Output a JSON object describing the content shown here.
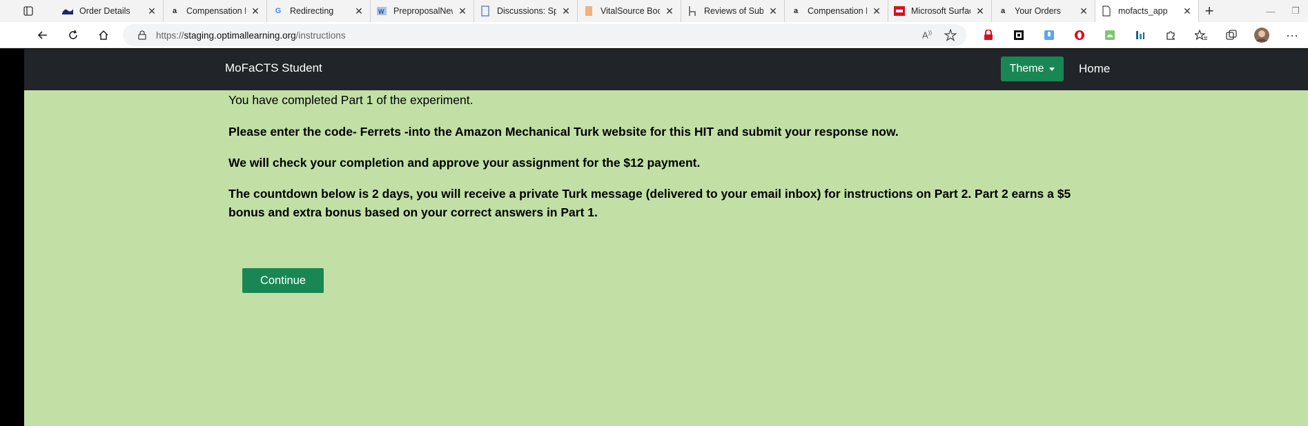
{
  "browser": {
    "tabs": [
      {
        "title": "Order Details",
        "icon": "navy-wave-icon"
      },
      {
        "title": "Compensation H",
        "icon": "amazon-icon"
      },
      {
        "title": "Redirecting",
        "icon": "google-icon"
      },
      {
        "title": "PreproposalNew",
        "icon": "word-icon"
      },
      {
        "title": "Discussions: Spr",
        "icon": "doc-blue-icon"
      },
      {
        "title": "VitalSource Boo",
        "icon": "book-icon"
      },
      {
        "title": "Reviews of Subm",
        "icon": "chair-icon"
      },
      {
        "title": "Compensation H",
        "icon": "amazon-icon"
      },
      {
        "title": "Microsoft Surfac",
        "icon": "bestbuy-icon"
      },
      {
        "title": "Your Orders",
        "icon": "amazon-icon"
      },
      {
        "title": "mofacts_app",
        "icon": "page-icon",
        "active": true
      }
    ],
    "url_scheme": "https://",
    "url_host": "staging.optimallearning.org",
    "url_path": "/instructions"
  },
  "nav": {
    "brand": "MoFaCTS Student",
    "theme_label": "Theme",
    "home_label": "Home"
  },
  "content": {
    "line1": "You have completed Part 1 of the experiment.",
    "line2": "Please enter the code- Ferrets -into the Amazon Mechanical Turk website for this HIT and submit your response now.",
    "line3": "We will check your completion and approve your assignment for the $12 payment.",
    "line4a": "The countdown below is 2 days, you will receive a private Turk message (delivered to your email inbox) for instructions on Part 2. Part 2 earns a $5",
    "line4b": "bonus and extra bonus based on your correct answers in Part 1.",
    "continue_label": "Continue"
  },
  "colors": {
    "page_bg": "#c2e0a6",
    "navbar_bg": "#212529",
    "accent": "#198754"
  }
}
